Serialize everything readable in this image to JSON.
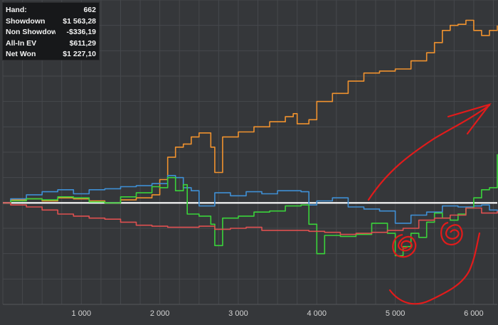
{
  "stats": {
    "rows": [
      {
        "label": "Hand:",
        "value": "662"
      },
      {
        "label": "Showdown",
        "value": "$1 563,28"
      },
      {
        "label": "Non Showdown",
        "value": "-$336,19"
      },
      {
        "label": "All-In EV",
        "value": "$611,29"
      },
      {
        "label": "Net Won",
        "value": "$1 227,10"
      }
    ]
  },
  "chart_data": {
    "type": "line",
    "title": "",
    "xlabel": "",
    "ylabel": "",
    "xlim": [
      0,
      6300
    ],
    "x_ticks": [
      1000,
      2000,
      3000,
      4000,
      5000,
      6000
    ],
    "x_tick_labels": [
      "1 000",
      "2 000",
      "3 000",
      "4 000",
      "5 000",
      "6 000"
    ],
    "ylim": [
      -1000,
      2000
    ],
    "grid": true,
    "legend": "none",
    "zero_line_color": "#ffffff",
    "series": [
      {
        "color": "#f0922e",
        "x": [
          0,
          100,
          300,
          500,
          700,
          900,
          1100,
          1300,
          1500,
          1700,
          1900,
          2000,
          2100,
          2200,
          2300,
          2400,
          2500,
          2650,
          2700,
          2800,
          3000,
          3200,
          3400,
          3600,
          3700,
          3750,
          3900,
          4000,
          4200,
          4400,
          4600,
          4800,
          5000,
          5200,
          5400,
          5500,
          5600,
          5700,
          5800,
          5900,
          6000,
          6100,
          6200,
          6300
        ],
        "y": [
          0,
          30,
          40,
          20,
          50,
          40,
          20,
          0,
          30,
          50,
          80,
          230,
          450,
          550,
          580,
          650,
          690,
          550,
          300,
          650,
          700,
          750,
          800,
          850,
          880,
          780,
          820,
          1000,
          1080,
          1200,
          1280,
          1300,
          1320,
          1400,
          1480,
          1580,
          1700,
          1750,
          1760,
          1800,
          1700,
          1650,
          1700,
          1750
        ]
      },
      {
        "color": "#3f8fd4",
        "x": [
          0,
          100,
          300,
          500,
          700,
          900,
          1100,
          1300,
          1500,
          1700,
          1900,
          2100,
          2200,
          2300,
          2400,
          2500,
          2700,
          2900,
          3100,
          3300,
          3500,
          3800,
          3900,
          4000,
          4200,
          4400,
          4600,
          4800,
          5000,
          5200,
          5400,
          5600,
          5800,
          6000,
          6100,
          6200,
          6300
        ],
        "y": [
          0,
          40,
          80,
          110,
          130,
          90,
          130,
          140,
          160,
          170,
          190,
          270,
          250,
          150,
          120,
          -30,
          100,
          70,
          110,
          90,
          120,
          110,
          -20,
          20,
          50,
          -40,
          -60,
          -80,
          -200,
          -120,
          -90,
          -30,
          -40,
          -30,
          -20,
          -70,
          -100
        ]
      },
      {
        "color": "#3ad33a",
        "x": [
          0,
          100,
          300,
          500,
          700,
          900,
          1100,
          1300,
          1500,
          1700,
          1900,
          2000,
          2100,
          2200,
          2300,
          2350,
          2500,
          2650,
          2700,
          2800,
          3000,
          3200,
          3400,
          3600,
          3800,
          3900,
          4000,
          4100,
          4300,
          4500,
          4700,
          4900,
          5000,
          5100,
          5200,
          5300,
          5400,
          5500,
          5600,
          5700,
          5800,
          5900,
          6000,
          6100,
          6200,
          6300
        ],
        "y": [
          0,
          20,
          40,
          30,
          60,
          50,
          10,
          0,
          60,
          100,
          160,
          150,
          250,
          120,
          180,
          -110,
          -130,
          -210,
          -420,
          -150,
          -130,
          -90,
          -80,
          -30,
          -20,
          -210,
          -500,
          -320,
          -330,
          -310,
          -200,
          -300,
          -520,
          -430,
          -300,
          -340,
          -190,
          -100,
          -150,
          -170,
          -110,
          -50,
          50,
          130,
          150,
          480
        ]
      },
      {
        "color": "#de5050",
        "x": [
          0,
          100,
          300,
          500,
          700,
          900,
          1100,
          1300,
          1500,
          1700,
          1900,
          2100,
          2300,
          2500,
          2700,
          2900,
          3100,
          3300,
          3500,
          3700,
          3900,
          4100,
          4300,
          4500,
          4700,
          4900,
          5100,
          5300,
          5500,
          5700,
          5900,
          6100,
          6300
        ],
        "y": [
          0,
          -20,
          -40,
          -70,
          -110,
          -130,
          -150,
          -160,
          -190,
          -220,
          -230,
          -240,
          -240,
          -230,
          -260,
          -250,
          -240,
          -270,
          -270,
          -270,
          -280,
          -290,
          -310,
          -300,
          -290,
          -270,
          -250,
          -170,
          -150,
          -120,
          -50,
          -100,
          -80
        ]
      }
    ]
  },
  "annotations": {
    "color": "#e21b1b",
    "shapes": [
      "hand-drawn-arrow",
      "hand-drawn-circle",
      "hand-drawn-circle",
      "hand-drawn-curve"
    ]
  }
}
